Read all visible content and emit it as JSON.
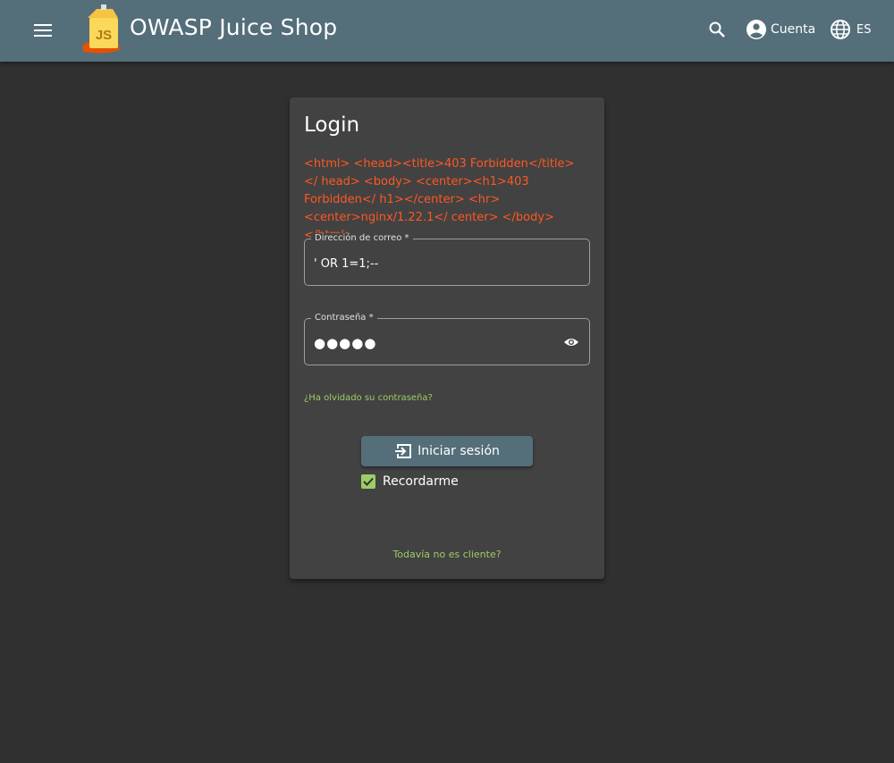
{
  "header": {
    "title": "OWASP Juice Shop",
    "account_label": "Cuenta",
    "language_label": "ES",
    "logo_text": "JS"
  },
  "login": {
    "title": "Login",
    "error_message": "<html> <head><title>403 Forbidden</title></ head> <body> <center><h1>403 Forbidden</ h1></center> <hr><center>nginx/1.22.1</ center> </body> </html>",
    "email_label": "Dirección de correo *",
    "email_value": "' OR 1=1;--",
    "password_label": "Contraseña *",
    "password_value": "●●●●●",
    "forgot_password": "¿Ha olvidado su contraseña?",
    "login_button": "Iniciar sesión",
    "remember_me": "Recordarme",
    "remember_checked": true,
    "register_link": "Todavía no es cliente?"
  },
  "colors": {
    "toolbar": "#546e7a",
    "background": "#303030",
    "card": "#424242",
    "error": "#ff5722",
    "accent": "#9ccc65"
  },
  "icons": [
    "menu-icon",
    "search-icon",
    "account-circle-icon",
    "language-icon",
    "visibility-icon",
    "login-icon",
    "check-icon"
  ]
}
